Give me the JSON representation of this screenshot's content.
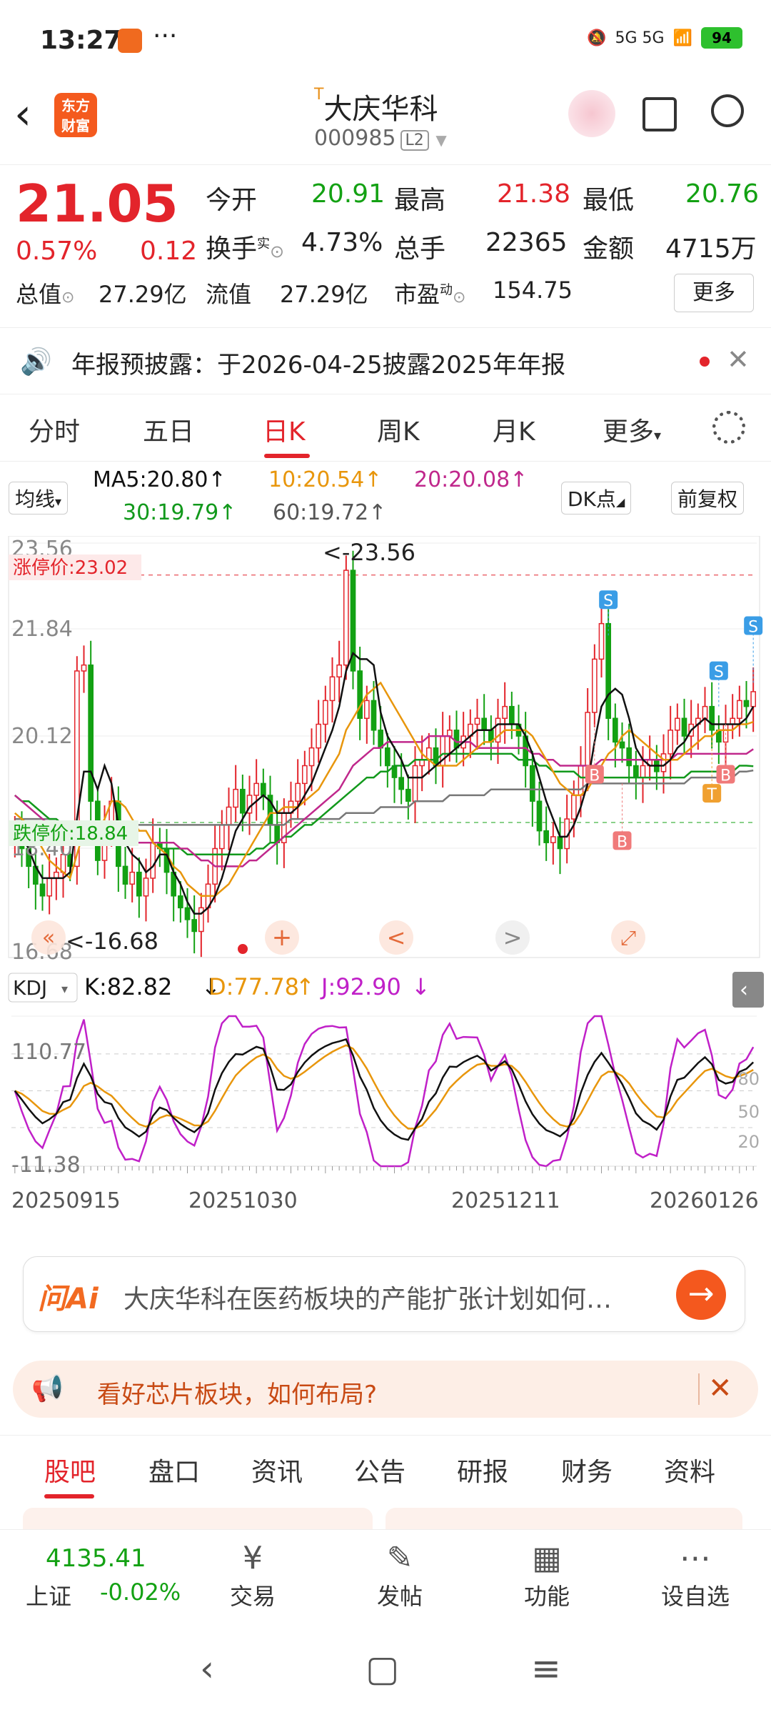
{
  "status_bar": {
    "time": "13:27",
    "dots": "···",
    "network": "5G 5G",
    "battery": "94"
  },
  "header": {
    "logo_line1": "东方",
    "logo_line2": "财富",
    "name_sup": "T",
    "name": "大庆华科",
    "code": "000985",
    "level": "L2"
  },
  "quote": {
    "price": "21.05",
    "change_pct": "0.57%",
    "change_val": "0.12",
    "open_label": "今开",
    "open": "20.91",
    "high_label": "最高",
    "high": "21.38",
    "low_label": "最低",
    "low": "20.76",
    "turnover_label": "换手",
    "turnover_sup": "实",
    "turnover": "4.73%",
    "volume_label": "总手",
    "volume": "22365",
    "amount_label": "金额",
    "amount": "4715万",
    "mcap_label": "总值",
    "mcap": "27.29亿",
    "float_label": "流值",
    "float_cap": "27.29亿",
    "pe_label": "市盈",
    "pe_sup": "动",
    "pe": "154.75",
    "more": "更多"
  },
  "notice": {
    "text": "年报预披露：于2026-04-25披露2025年年报"
  },
  "tabs": [
    "分时",
    "五日",
    "日K",
    "周K",
    "月K",
    "更多"
  ],
  "ma_legend": {
    "selector": "均线",
    "ma5": "MA5:20.80",
    "ma10": "10:20.54",
    "ma20": "20:20.08",
    "ma30": "30:19.79",
    "ma60": "60:19.72",
    "dk": "DK点",
    "adjust": "前复权",
    "colors": {
      "ma5": "#111111",
      "ma10": "#e8960c",
      "ma20": "#c0288c",
      "ma30": "#12991c",
      "ma60": "#777777"
    }
  },
  "price_axis": {
    "top": "23.56",
    "t2": "21.84",
    "t3": "20.12",
    "t4": "18.40",
    "bottom": "16.68"
  },
  "limit": {
    "up": "涨停价:23.02",
    "down": "跌停价:18.84"
  },
  "markers": {
    "high": "<-23.56",
    "low": "<-16.68",
    "s": "S",
    "b": "B",
    "t": "T"
  },
  "chart_data": {
    "type": "candlestick",
    "ylim": [
      16.68,
      23.56
    ],
    "limit_up": 23.02,
    "limit_down": 18.84,
    "x_ticks": [
      "20250915",
      "20251030",
      "20251211",
      "20260126"
    ],
    "kdj": {
      "label": "KDJ",
      "k": "K:82.82",
      "d": "D:77.78",
      "j": "J:92.90",
      "ylim": [
        -11.38,
        110.77
      ],
      "top": "110.77",
      "bottom": "-11.38",
      "lvl80": "80",
      "lvl50": "50",
      "lvl20": "20"
    },
    "close": [
      18.7,
      18.4,
      18.1,
      17.8,
      17.6,
      17.9,
      18.0,
      18.3,
      18.1,
      21.4,
      21.5,
      19.2,
      18.2,
      18.8,
      19.2,
      18.1,
      17.8,
      18.0,
      17.6,
      17.9,
      18.5,
      18.4,
      18.0,
      17.6,
      17.4,
      17.2,
      17.0,
      17.4,
      17.8,
      18.4,
      18.8,
      19.1,
      19.4,
      19.0,
      19.3,
      19.5,
      19.3,
      18.8,
      18.5,
      19.0,
      19.2,
      19.5,
      19.8,
      20.1,
      20.5,
      20.9,
      21.3,
      21.5,
      23.1,
      21.4,
      20.6,
      20.9,
      20.4,
      20.1,
      19.8,
      19.6,
      19.4,
      19.2,
      19.8,
      19.9,
      20.1,
      19.8,
      20.3,
      20.4,
      20.1,
      20.3,
      20.5,
      20.6,
      20.4,
      20.2,
      20.6,
      20.8,
      20.5,
      20.3,
      19.8,
      19.2,
      18.7,
      18.5,
      18.6,
      18.4,
      18.9,
      19.3,
      19.8,
      20.7,
      21.6,
      22.2,
      20.6,
      20.2,
      20.1,
      19.8,
      19.6,
      19.8,
      19.9,
      19.7,
      20.0,
      20.4,
      20.6,
      20.3,
      20.5,
      20.6,
      20.8,
      20.4,
      20.2,
      20.5,
      20.6,
      20.9,
      20.8,
      21.05
    ],
    "ma5": [
      18.8,
      18.6,
      18.4,
      18.1,
      17.9,
      17.9,
      17.9,
      17.9,
      18.0,
      18.9,
      19.7,
      19.7,
      19.4,
      19.8,
      19.5,
      18.8,
      18.5,
      18.3,
      18.2,
      18.0,
      18.1,
      18.3,
      18.3,
      18.0,
      17.8,
      17.5,
      17.3,
      17.3,
      17.4,
      17.6,
      17.9,
      18.3,
      18.7,
      18.9,
      19.1,
      19.2,
      19.3,
      19.2,
      19.0,
      19.0,
      19.0,
      19.1,
      19.3,
      19.5,
      19.8,
      20.1,
      20.4,
      20.8,
      21.4,
      21.7,
      21.6,
      21.6,
      21.5,
      20.7,
      20.3,
      20.1,
      19.9,
      19.6,
      19.6,
      19.6,
      19.7,
      19.8,
      19.9,
      20.0,
      20.1,
      20.2,
      20.3,
      20.4,
      20.4,
      20.4,
      20.5,
      20.5,
      20.5,
      20.5,
      20.3,
      20.0,
      19.6,
      19.2,
      18.9,
      18.6,
      18.6,
      18.8,
      19.1,
      19.5,
      20.2,
      20.8,
      21.0,
      21.1,
      21.0,
      20.6,
      20.1,
      19.9,
      19.8,
      19.8,
      19.8,
      19.9,
      20.1,
      20.2,
      20.4,
      20.5,
      20.6,
      20.5,
      20.5,
      20.5,
      20.5,
      20.5,
      20.6,
      20.8
    ],
    "ma10": [
      19.0,
      18.9,
      18.8,
      18.6,
      18.4,
      18.2,
      18.1,
      18.0,
      17.9,
      18.3,
      18.7,
      18.8,
      18.7,
      18.9,
      19.2,
      19.2,
      19.1,
      18.9,
      18.7,
      18.7,
      18.5,
      18.4,
      18.3,
      18.1,
      18.0,
      17.8,
      17.7,
      17.6,
      17.6,
      17.6,
      17.7,
      17.8,
      18.0,
      18.2,
      18.4,
      18.6,
      18.8,
      19.0,
      19.0,
      19.1,
      19.1,
      19.1,
      19.2,
      19.3,
      19.4,
      19.6,
      19.8,
      20.0,
      20.4,
      20.6,
      20.8,
      21.0,
      21.1,
      21.2,
      21.0,
      20.8,
      20.6,
      20.4,
      20.2,
      20.0,
      19.9,
      19.8,
      19.8,
      19.8,
      19.8,
      19.9,
      20.0,
      20.1,
      20.2,
      20.2,
      20.3,
      20.4,
      20.4,
      20.4,
      20.4,
      20.3,
      20.1,
      19.9,
      19.7,
      19.5,
      19.4,
      19.3,
      19.3,
      19.4,
      19.6,
      19.8,
      20.0,
      20.1,
      20.3,
      20.4,
      20.3,
      20.2,
      20.1,
      20.0,
      19.9,
      19.9,
      19.9,
      20.0,
      20.1,
      20.2,
      20.3,
      20.3,
      20.4,
      20.4,
      20.4,
      20.5,
      20.5,
      20.54
    ],
    "ma20": [
      19.3,
      19.2,
      19.1,
      19.0,
      18.9,
      18.8,
      18.7,
      18.6,
      18.6,
      18.6,
      18.7,
      18.7,
      18.6,
      18.6,
      18.6,
      18.6,
      18.6,
      18.5,
      18.5,
      18.5,
      18.5,
      18.5,
      18.5,
      18.5,
      18.4,
      18.4,
      18.3,
      18.2,
      18.2,
      18.1,
      18.1,
      18.1,
      18.1,
      18.1,
      18.2,
      18.2,
      18.3,
      18.4,
      18.5,
      18.6,
      18.7,
      18.8,
      18.9,
      19.0,
      19.1,
      19.2,
      19.3,
      19.4,
      19.6,
      19.8,
      19.9,
      20.0,
      20.1,
      20.1,
      20.2,
      20.2,
      20.2,
      20.2,
      20.2,
      20.2,
      20.3,
      20.3,
      20.3,
      20.3,
      20.2,
      20.2,
      20.2,
      20.1,
      20.1,
      20.1,
      20.1,
      20.1,
      20.1,
      20.1,
      20.1,
      20.0,
      20.0,
      19.9,
      19.9,
      19.8,
      19.8,
      19.8,
      19.8,
      19.8,
      19.8,
      19.9,
      19.9,
      19.9,
      19.9,
      19.9,
      19.9,
      19.9,
      19.9,
      19.9,
      19.9,
      19.9,
      20.0,
      20.0,
      20.0,
      20.0,
      20.0,
      20.0,
      20.0,
      20.0,
      20.0,
      20.0,
      20.0,
      20.08
    ],
    "ma30": [
      19.3,
      19.2,
      19.2,
      19.1,
      19.0,
      18.9,
      18.9,
      18.8,
      18.8,
      18.8,
      18.8,
      18.7,
      18.7,
      18.6,
      18.6,
      18.6,
      18.6,
      18.5,
      18.5,
      18.5,
      18.5,
      18.4,
      18.4,
      18.4,
      18.4,
      18.3,
      18.3,
      18.3,
      18.3,
      18.3,
      18.3,
      18.3,
      18.3,
      18.3,
      18.3,
      18.4,
      18.4,
      18.5,
      18.5,
      18.6,
      18.6,
      18.7,
      18.8,
      18.8,
      18.9,
      19.0,
      19.1,
      19.2,
      19.3,
      19.4,
      19.5,
      19.6,
      19.6,
      19.7,
      19.7,
      19.8,
      19.8,
      19.8,
      19.9,
      19.9,
      19.9,
      19.9,
      20.0,
      20.0,
      20.0,
      20.0,
      20.0,
      20.0,
      20.0,
      20.0,
      20.0,
      20.0,
      20.0,
      19.9,
      19.9,
      19.9,
      19.8,
      19.8,
      19.7,
      19.7,
      19.7,
      19.7,
      19.6,
      19.6,
      19.6,
      19.6,
      19.6,
      19.6,
      19.6,
      19.6,
      19.6,
      19.6,
      19.6,
      19.6,
      19.6,
      19.6,
      19.6,
      19.6,
      19.7,
      19.7,
      19.7,
      19.7,
      19.7,
      19.7,
      19.7,
      19.8,
      19.8,
      19.79
    ],
    "ma60": [
      18.9,
      18.9,
      18.9,
      18.9,
      18.9,
      18.9,
      18.9,
      18.8,
      18.8,
      18.8,
      18.8,
      18.8,
      18.8,
      18.8,
      18.8,
      18.8,
      18.8,
      18.8,
      18.8,
      18.8,
      18.8,
      18.8,
      18.8,
      18.8,
      18.8,
      18.8,
      18.8,
      18.8,
      18.8,
      18.8,
      18.8,
      18.8,
      18.8,
      18.8,
      18.8,
      18.8,
      18.8,
      18.8,
      18.8,
      18.8,
      18.9,
      18.9,
      18.9,
      18.9,
      18.9,
      18.9,
      18.9,
      18.9,
      19.0,
      19.0,
      19.0,
      19.0,
      19.0,
      19.1,
      19.1,
      19.1,
      19.1,
      19.1,
      19.2,
      19.2,
      19.2,
      19.2,
      19.2,
      19.3,
      19.3,
      19.3,
      19.3,
      19.3,
      19.3,
      19.4,
      19.4,
      19.4,
      19.4,
      19.4,
      19.4,
      19.4,
      19.4,
      19.4,
      19.4,
      19.4,
      19.4,
      19.4,
      19.4,
      19.5,
      19.5,
      19.5,
      19.5,
      19.5,
      19.5,
      19.5,
      19.5,
      19.5,
      19.5,
      19.5,
      19.5,
      19.5,
      19.5,
      19.5,
      19.6,
      19.6,
      19.6,
      19.6,
      19.6,
      19.6,
      19.6,
      19.7,
      19.7,
      19.72
    ]
  },
  "chart_tools": {
    "left": "«",
    "plus": "+",
    "prev": "<",
    "next": ">",
    "expand": "⤢"
  },
  "ai": {
    "logo": "问Ai",
    "text": "大庆华科在医药板块的产能扩张计划如何…",
    "go": "→"
  },
  "promo": {
    "text": "看好芯片板块，如何布局?",
    "close": "✕"
  },
  "bottom_tabs": [
    "股吧",
    "盘口",
    "资讯",
    "公告",
    "研报",
    "财务",
    "资料"
  ],
  "dock": {
    "index_value": "4135.41",
    "index_name": "上证",
    "index_chg": "-0.02%",
    "items": [
      {
        "label": "交易",
        "icon": "¥"
      },
      {
        "label": "发帖",
        "icon": "✎"
      },
      {
        "label": "功能",
        "icon": "▦"
      },
      {
        "label": "设自选",
        "icon": "⋯"
      }
    ]
  },
  "navbar": {
    "back": "‹",
    "home": "▢",
    "menu": "≡"
  }
}
